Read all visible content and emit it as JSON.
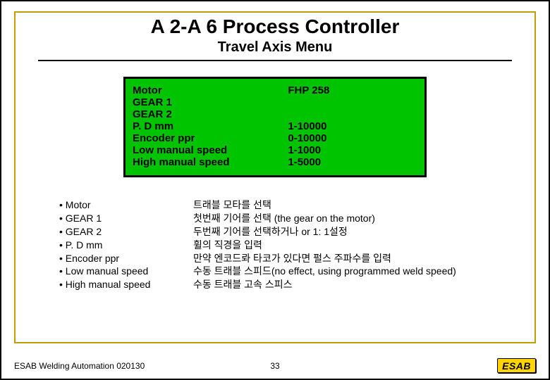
{
  "header": {
    "title": "A 2-A 6 Process Controller",
    "subtitle": "Travel Axis Menu"
  },
  "panel": {
    "rows": [
      {
        "left": "Motor",
        "right": "FHP 258"
      },
      {
        "left": "GEAR 1",
        "right": ""
      },
      {
        "left": "GEAR 2",
        "right": ""
      },
      {
        "left": "P. D  mm",
        "right": "1-10000"
      },
      {
        "left": "Encoder ppr",
        "right": "0-10000"
      },
      {
        "left": "Low manual speed",
        "right": "1-1000"
      },
      {
        "left": "High manual speed",
        "right": "1-5000"
      }
    ]
  },
  "bullets": [
    {
      "name": "Motor",
      "desc": "트래블 모타를 선택"
    },
    {
      "name": "GEAR 1",
      "desc": "첫번째 기어를 선택 (the gear on the motor)"
    },
    {
      "name": "GEAR 2",
      "desc": "두번째 기어를 선택하거나 or  1: 1설정"
    },
    {
      "name": "P. D mm",
      "desc": "휠의 직경을 입력"
    },
    {
      "name": "Encoder ppr",
      "desc": "만약 엔코드롸 타코가 있다면 펄스 주파수를 입력"
    },
    {
      "name": "Low manual speed",
      "desc": "수동 트래블 스피드(no effect, using programmed weld speed)"
    },
    {
      "name": "High manual speed",
      "desc": "수동 트래블 고속 스피스"
    }
  ],
  "footer": {
    "left": "ESAB Welding Automation 020130",
    "page": "33",
    "logo": "ESAB"
  }
}
